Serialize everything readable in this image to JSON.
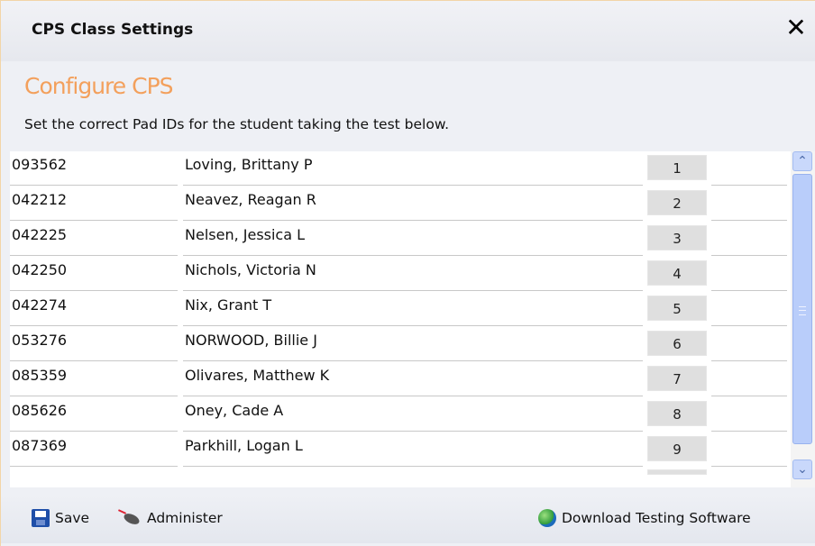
{
  "window": {
    "title": "CPS Class Settings",
    "close_label": "✕"
  },
  "header": {
    "heading": "Configure CPS",
    "description": "Set the correct Pad IDs for the student taking the test below."
  },
  "students": [
    {
      "id": "093562",
      "name": "Loving, Brittany P",
      "pad": "1"
    },
    {
      "id": "042212",
      "name": "Neavez, Reagan R",
      "pad": "2"
    },
    {
      "id": "042225",
      "name": "Nelsen, Jessica L",
      "pad": "3"
    },
    {
      "id": "042250",
      "name": "Nichols, Victoria N",
      "pad": "4"
    },
    {
      "id": "042274",
      "name": "Nix, Grant T",
      "pad": "5"
    },
    {
      "id": "053276",
      "name": "NORWOOD, Billie J",
      "pad": "6"
    },
    {
      "id": "085359",
      "name": "Olivares, Matthew K",
      "pad": "7"
    },
    {
      "id": "085626",
      "name": "Oney, Cade A",
      "pad": "8"
    },
    {
      "id": "087369",
      "name": "Parkhill, Logan L",
      "pad": "9"
    }
  ],
  "scrollbar": {
    "up_icon": "chevron-up-icon",
    "down_icon": "chevron-down-icon"
  },
  "footer": {
    "save_label": "Save",
    "administer_label": "Administer",
    "download_label": "Download Testing Software"
  },
  "colors": {
    "heading": "#f3a05c",
    "scroll_thumb": "#b9cdfa"
  }
}
